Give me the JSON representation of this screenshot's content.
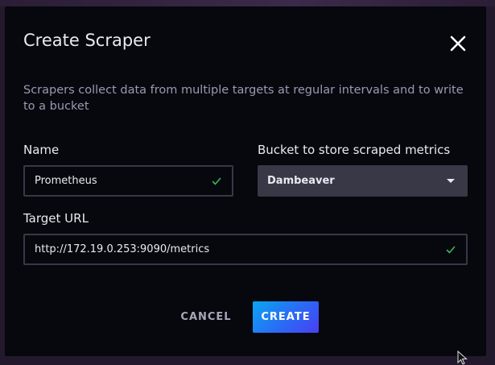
{
  "dialog": {
    "title": "Create Scraper",
    "close_icon": "close-icon",
    "description": "Scrapers collect data from multiple targets at regular intervals and to write to a bucket"
  },
  "form": {
    "name": {
      "label": "Name",
      "value": "Prometheus",
      "valid_icon": "check-icon"
    },
    "bucket": {
      "label": "Bucket to store scraped metrics",
      "selected": "Dambeaver",
      "dropdown_icon": "caret-down-icon"
    },
    "target_url": {
      "label": "Target URL",
      "value": "http://172.19.0.253:9090/metrics",
      "valid_icon": "check-icon"
    }
  },
  "actions": {
    "cancel_label": "CANCEL",
    "create_label": "CREATE"
  },
  "colors": {
    "dialog_bg": "#07070e",
    "input_border": "#383846",
    "valid_check": "#34bb55",
    "primary_gradient_start": "#0aa5f0",
    "primary_gradient_end": "#4b3ff0"
  }
}
